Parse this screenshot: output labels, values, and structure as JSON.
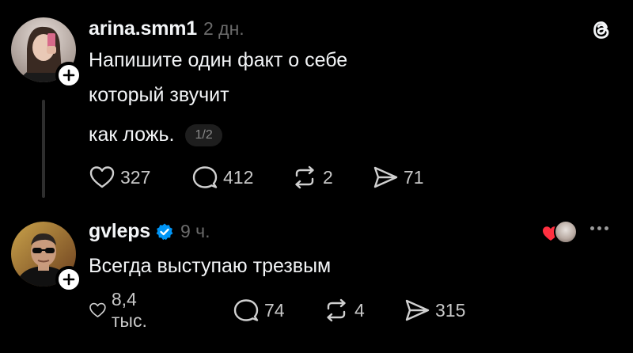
{
  "posts": [
    {
      "username": "arina.smm1",
      "time": "2 дн.",
      "lines": [
        "Напишите один факт о себе",
        "который звучит",
        "как ложь."
      ],
      "page_indicator": "1/2",
      "likes": "327",
      "comments": "412",
      "reposts": "2",
      "shares": "71",
      "avatar_icon": "avatar-girl-selfie",
      "corner_icon": "threads-logo-icon"
    },
    {
      "username": "gvleps",
      "time": "9 ч.",
      "verified": true,
      "lines": [
        "Всегда выступаю трезвым"
      ],
      "likes": "8,4 тыс.",
      "comments": "74",
      "reposts": "4",
      "shares": "315",
      "avatar_icon": "avatar-man-sunglasses",
      "corner_icon": "more-dots-icon"
    }
  ],
  "colors": {
    "background": "#000000",
    "text": "#f3f5f7",
    "muted": "#6b6b6b",
    "verified_blue": "#0095f6",
    "heart_red": "#ff3040"
  }
}
